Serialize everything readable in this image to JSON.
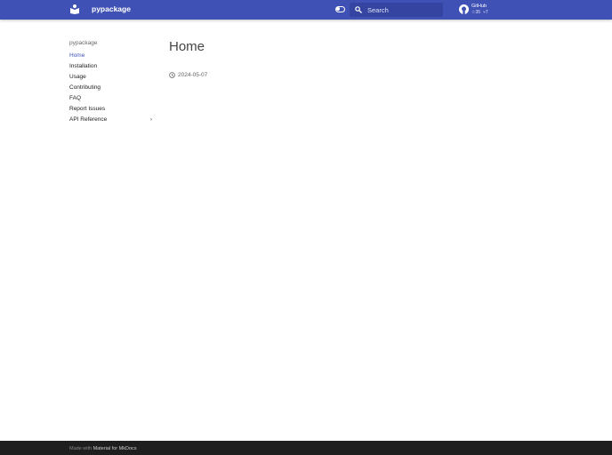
{
  "header": {
    "title": "pypackage",
    "search_placeholder": "Search",
    "repo": {
      "name": "GitHub",
      "stars": "35",
      "forks": "7"
    }
  },
  "sidebar": {
    "heading": "pypackage",
    "items": [
      {
        "label": "Home"
      },
      {
        "label": "Installation"
      },
      {
        "label": "Usage"
      },
      {
        "label": "Contributing"
      },
      {
        "label": "FAQ"
      },
      {
        "label": "Report Issues"
      },
      {
        "label": "API Reference"
      }
    ]
  },
  "content": {
    "title": "Home",
    "date": "2024-05-07"
  },
  "footer": {
    "prefix": "Made with",
    "link": "Material for MkDocs"
  }
}
